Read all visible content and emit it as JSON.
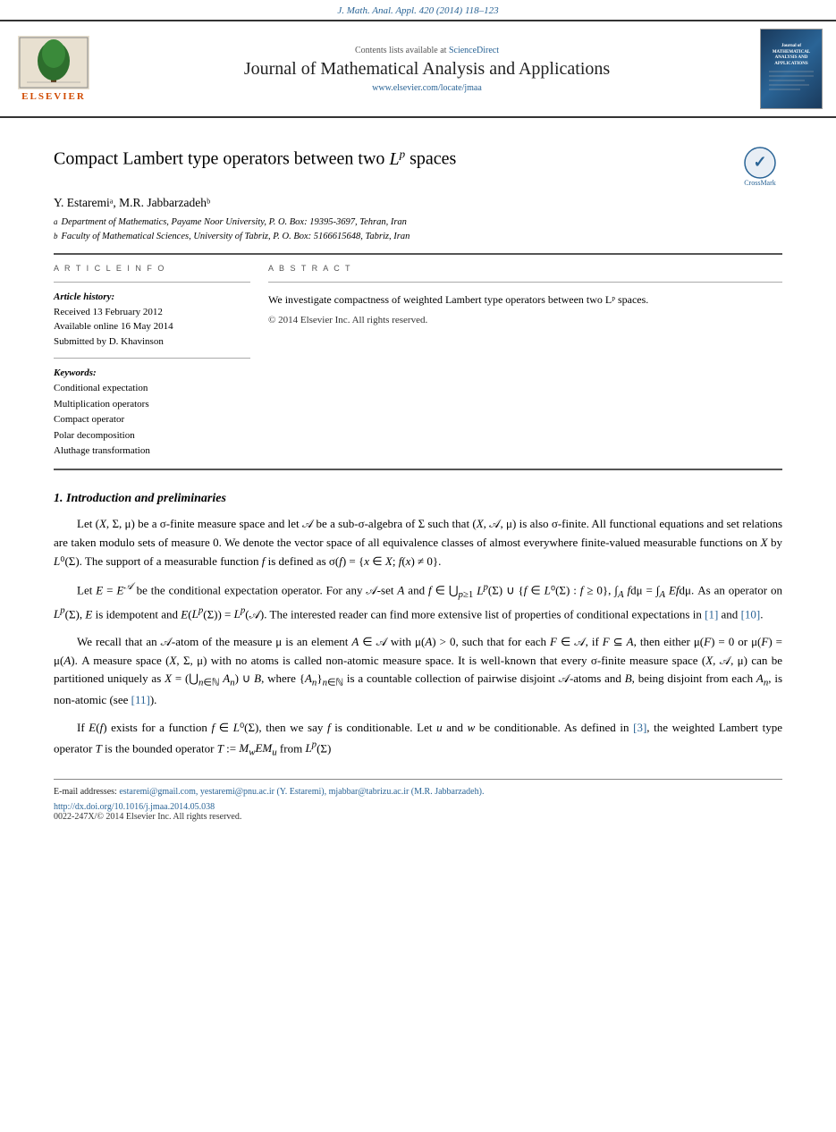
{
  "journal_ref": "J. Math. Anal. Appl. 420 (2014) 118–123",
  "header": {
    "contents_label": "Contents lists available at",
    "sciencedirect": "ScienceDirect",
    "journal_title": "Journal of Mathematical Analysis and Applications",
    "journal_url": "www.elsevier.com/locate/jmaa",
    "elsevier_label": "ELSEVIER"
  },
  "paper": {
    "title_prefix": "Compact Lambert type operators between two ",
    "title_Lp": "L",
    "title_p": "p",
    "title_suffix": " spaces",
    "crossmark_label": "CrossMark"
  },
  "authors": {
    "text": "Y. Estaremiᵃ, M.R. Jabbarzadehᵇ"
  },
  "affiliations": [
    {
      "sup": "a",
      "text": "Department of Mathematics, Payame Noor University, P. O. Box: 19395-3697, Tehran, Iran"
    },
    {
      "sup": "b",
      "text": "Faculty of Mathematical Sciences, University of Tabriz, P. O. Box: 5166615648, Tabriz, Iran"
    }
  ],
  "article_info": {
    "section_header": "A R T I C L E   I N F O",
    "history_label": "Article history:",
    "received": "Received 13 February 2012",
    "available": "Available online 16 May 2014",
    "submitted": "Submitted by D. Khavinson",
    "keywords_label": "Keywords:",
    "keywords": [
      "Conditional expectation",
      "Multiplication operators",
      "Compact operator",
      "Polar decomposition",
      "Aluthage transformation"
    ]
  },
  "abstract": {
    "section_header": "A B S T R A C T",
    "text": "We investigate compactness of weighted Lambert type operators between two Lᵖ spaces.",
    "copyright": "© 2014 Elsevier Inc. All rights reserved."
  },
  "sections": [
    {
      "number": "1.",
      "title": "Introduction and preliminaries",
      "paragraphs": [
        "Let (X, Σ, μ) be a σ-finite measure space and let 𝓜 be a sub-σ-algebra of Σ such that (X, 𝓜, μ) is also σ-finite. All functional equations and set relations are taken modulo sets of measure 0. We denote the vector space of all equivalence classes of almost everywhere finite-valued measurable functions on X by L°(Σ). The support of a measurable function f is defined as σ(f) = {x ∈ X; f(x) ≠ 0}.",
        "Let E = Eᴬ be the conditional expectation operator. For any 𝓜-set A and f ∈ ⋃ₚ≥1 Lᵖ(Σ) ∪ {f ∈ L°(Σ) : f ≥ 0}, ∫ₐ fdμ = ∫ₐ Efdμ. As an operator on Lᵖ(Σ), E is idempotent and E(Lᵖ(Σ)) = Lᵖ(𝓜). The interested reader can find more extensive list of properties of conditional expectations in [1] and [10].",
        "We recall that an 𝓜-atom of the measure μ is an element A ∈ 𝓜 with μ(A) > 0, such that for each F ∈ 𝓜, if F ⊆ A, then either μ(F) = 0 or μ(F) = μ(A). A measure space (X, Σ, μ) with no atoms is called non-atomic measure space. It is well-known that every σ-finite measure space (X, 𝓜, μ) can be partitioned uniquely as X = (⋃ₙ∈ℕ Aₙ) ∪ B, where {Aₙ}ₙ∈ℕ is a countable collection of pairwise disjoint 𝓜-atoms and B, being disjoint from each Aₙ, is non-atomic (see [11]).",
        "If E(f) exists for a function f ∈ L°(Σ), then we say f is conditionable. Let u and w be conditionable. As defined in [3], the weighted Lambert type operator T is the bounded operator T := MᵤEMᵤ from Lᵖ(Σ)"
      ]
    }
  ],
  "footnotes": {
    "email_label": "E-mail addresses:",
    "emails": "estaremi@gmail.com, yestaremi@pnu.ac.ir (Y. Estaremi), mjabbar@tabrizu.ac.ir (M.R. Jabbarzadeh).",
    "doi": "http://dx.doi.org/10.1016/j.jmaa.2014.05.038",
    "rights": "0022-247X/© 2014 Elsevier Inc. All rights reserved."
  }
}
